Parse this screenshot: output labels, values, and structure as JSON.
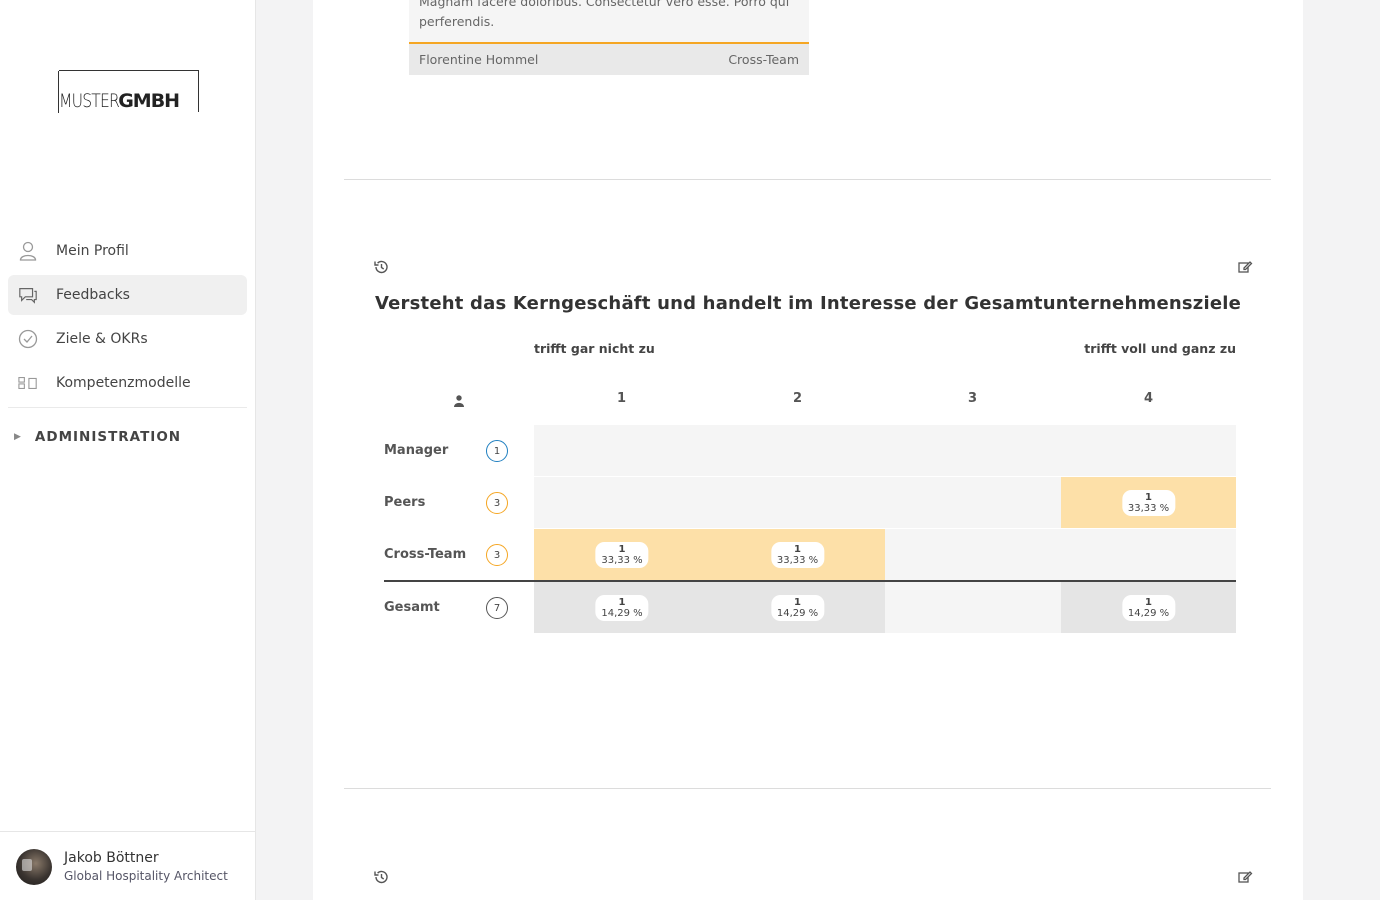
{
  "brand": {
    "logo_thin": "MUSTER",
    "logo_bold": "GMBH"
  },
  "nav": {
    "items": [
      {
        "label": "Mein Profil",
        "icon": "person-icon"
      },
      {
        "label": "Feedbacks",
        "icon": "chat-icon",
        "active": true
      },
      {
        "label": "Ziele & OKRs",
        "icon": "check-circle-icon"
      },
      {
        "label": "Kompetenzmodelle",
        "icon": "model-icon"
      }
    ],
    "admin_label": "ADMINISTRATION"
  },
  "user": {
    "name": "Jakob Böttner",
    "role": "Global Hospitality Architect"
  },
  "previous_card": {
    "text": "Magnam facere doloribus. Consectetur vero esse. Porro qui perferendis.",
    "author": "Florentine Hommel",
    "group": "Cross-Team"
  },
  "question": {
    "title": "Versteht das Kerngeschäft und handelt im Interesse der Gesamtunternehmensziele",
    "scale_low": "trifft gar nicht zu",
    "scale_high": "trifft voll und ganz zu",
    "columns": [
      "1",
      "2",
      "3",
      "4"
    ],
    "rows": [
      {
        "label": "Manager",
        "count": "1",
        "color": "#1f7fc0",
        "cells": [
          null,
          null,
          null,
          null
        ]
      },
      {
        "label": "Peers",
        "count": "3",
        "color": "#f5a623",
        "cells": [
          null,
          null,
          null,
          {
            "n": "1",
            "pct": "33,33 %"
          }
        ]
      },
      {
        "label": "Cross-Team",
        "count": "3",
        "color": "#f5a623",
        "cells": [
          {
            "n": "1",
            "pct": "33,33 %"
          },
          {
            "n": "1",
            "pct": "33,33 %"
          },
          null,
          null
        ]
      }
    ],
    "total": {
      "label": "Gesamt",
      "count": "7",
      "color": "#555555",
      "cells": [
        {
          "n": "1",
          "pct": "14,29 %"
        },
        {
          "n": "1",
          "pct": "14,29 %"
        },
        null,
        {
          "n": "1",
          "pct": "14,29 %"
        }
      ]
    }
  },
  "colors": {
    "highlight": "#fde0a8",
    "empty": "#f5f5f5",
    "total_filled": "#e5e5e5",
    "accent": "#f5a623"
  }
}
